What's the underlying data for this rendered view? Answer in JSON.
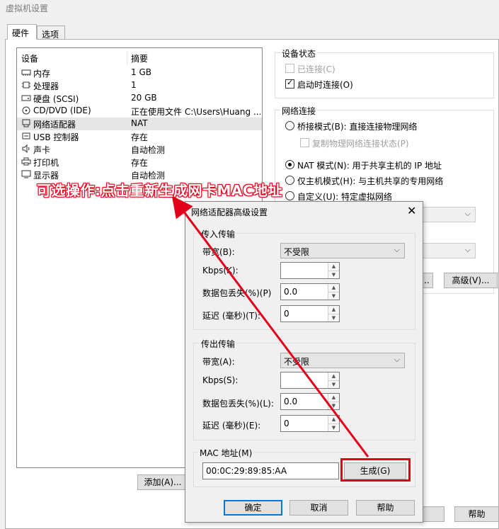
{
  "window": {
    "title": "虚拟机设置"
  },
  "tabs": [
    {
      "label": "硬件"
    },
    {
      "label": "选项"
    }
  ],
  "device_list": {
    "headers": {
      "device": "设备",
      "summary": "摘要"
    },
    "rows": [
      {
        "icon": "memory-icon",
        "name": "内存",
        "summary": "1 GB"
      },
      {
        "icon": "cpu-icon",
        "name": "处理器",
        "summary": "1"
      },
      {
        "icon": "hard-disk-icon",
        "name": "硬盘 (SCSI)",
        "summary": "20 GB"
      },
      {
        "icon": "cd-dvd-icon",
        "name": "CD/DVD (IDE)",
        "summary": "正在使用文件 C:\\Users\\Huang ..."
      },
      {
        "icon": "network-adapter-icon",
        "name": "网络适配器",
        "summary": "NAT",
        "selected": true
      },
      {
        "icon": "usb-icon",
        "name": "USB 控制器",
        "summary": "存在"
      },
      {
        "icon": "sound-card-icon",
        "name": "声卡",
        "summary": "自动检测"
      },
      {
        "icon": "printer-icon",
        "name": "打印机",
        "summary": "存在"
      },
      {
        "icon": "display-icon",
        "name": "显示器",
        "summary": "自动检测"
      }
    ]
  },
  "buttons": {
    "add": "添加(A)...",
    "help": "帮助",
    "advanced": "高级(V)...",
    "segment_ellipsis": "..."
  },
  "device_status": {
    "label": "设备状态",
    "connected": {
      "label": "已连接(C)",
      "checked": false,
      "disabled": true
    },
    "connect_at_power_on": {
      "label": "启动时连接(O)",
      "checked": true
    }
  },
  "network_connection": {
    "label": "网络连接",
    "bridged": "桥接模式(B): 直接连接物理网络",
    "replicate": "复制物理网络连接状态(P)",
    "nat": "NAT 模式(N): 用于共享主机的 IP 地址",
    "host_only": "仅主机模式(H): 与主机共享的专用网络",
    "custom": "自定义(U): 特定虚拟网络",
    "selected": "nat"
  },
  "annotation": {
    "text": "可选操作:点击重新生成网卡MAC地址",
    "color": "#e2001a"
  },
  "dialog": {
    "title": "网络适配器高级设置",
    "incoming": {
      "label": "传入传输",
      "bandwidth_label": "带宽(B):",
      "bandwidth_value": "不受限",
      "kbps_label": "Kbps(K):",
      "kbps_value": "",
      "loss_label": "数据包丢失(%)(P)",
      "loss_value": "0.0",
      "latency_label": "延迟 (毫秒)(T):",
      "latency_value": "0"
    },
    "outgoing": {
      "label": "传出传输",
      "bandwidth_label": "带宽(A):",
      "bandwidth_value": "不受限",
      "kbps_label": "Kbps(S):",
      "kbps_value": "",
      "loss_label": "数据包丢失(%)(L):",
      "loss_value": "0.0",
      "latency_label": "延迟 (毫秒)(E):",
      "latency_value": "0"
    },
    "mac": {
      "label": "MAC 地址(M)",
      "value": "00:0C:29:89:85:AA",
      "generate": "生成(G)"
    },
    "ok": "确定",
    "cancel": "取消",
    "help": "帮助"
  }
}
